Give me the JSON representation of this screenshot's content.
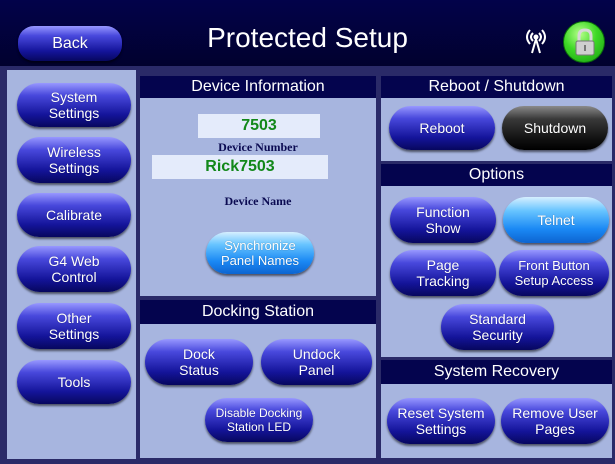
{
  "header": {
    "title": "Protected Setup",
    "back_label": "Back",
    "icons": {
      "signal": "wireless-signal-icon",
      "lock": "lock-icon"
    },
    "lock_color": "#3ed826"
  },
  "sidebar": {
    "items": [
      {
        "label": "System\nSettings"
      },
      {
        "label": "Wireless\nSettings"
      },
      {
        "label": "Calibrate"
      },
      {
        "label": "G4 Web\nControl"
      },
      {
        "label": "Other\nSettings"
      },
      {
        "label": "Tools"
      }
    ]
  },
  "device_info": {
    "heading": "Device Information",
    "number_value": "7503",
    "number_label": "Device Number",
    "name_value": "Rick7503",
    "name_label": "Device Name",
    "sync_label": "Synchronize\nPanel Names"
  },
  "docking": {
    "heading": "Docking Station",
    "dock_status_label": "Dock\nStatus",
    "undock_label": "Undock\nPanel",
    "disable_led_label": "Disable Docking\nStation LED"
  },
  "reboot": {
    "heading": "Reboot / Shutdown",
    "reboot_label": "Reboot",
    "shutdown_label": "Shutdown"
  },
  "options": {
    "heading": "Options",
    "function_show_label": "Function\nShow",
    "telnet_label": "Telnet",
    "page_tracking_label": "Page\nTracking",
    "front_button_label": "Front Button\nSetup Access",
    "standard_security_label": "Standard\nSecurity"
  },
  "recovery": {
    "heading": "System Recovery",
    "reset_label": "Reset System\nSettings",
    "remove_pages_label": "Remove User\nPages"
  },
  "colors": {
    "header_bg": "#02024a",
    "panel_bg": "#a7b5df",
    "section_header": "#04044e",
    "value_text": "#12881a",
    "button_blue": "#14149a",
    "button_bright": "#1a88f4",
    "button_dark": "#111111"
  }
}
